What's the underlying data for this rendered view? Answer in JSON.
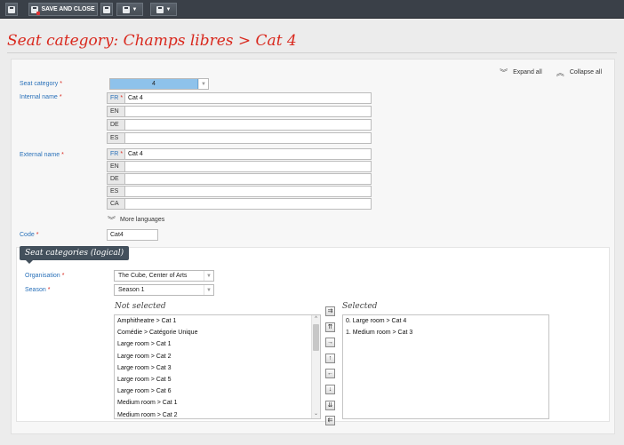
{
  "toolbar": {
    "save_and_close_label": "SAVE AND CLOSE"
  },
  "page": {
    "title": "Seat category: Champs libres > Cat 4"
  },
  "links": {
    "expand_all": "Expand all",
    "collapse_all": "Collapse all"
  },
  "form": {
    "seat_category": {
      "label": "Seat category",
      "value": "4"
    },
    "internal_name": {
      "label": "Internal name",
      "rows": [
        {
          "code": "FR",
          "value": "Cat 4"
        },
        {
          "code": "EN",
          "value": ""
        },
        {
          "code": "DE",
          "value": ""
        },
        {
          "code": "ES",
          "value": ""
        }
      ]
    },
    "external_name": {
      "label": "External name",
      "rows": [
        {
          "code": "FR",
          "value": "Cat 4"
        },
        {
          "code": "EN",
          "value": ""
        },
        {
          "code": "DE",
          "value": ""
        },
        {
          "code": "ES",
          "value": ""
        },
        {
          "code": "CA",
          "value": ""
        }
      ]
    },
    "more_languages": "More languages",
    "code": {
      "label": "Code",
      "value": "Cat4"
    },
    "required_marker": "*"
  },
  "logical": {
    "section_title": "Seat categories (logical)",
    "organisation": {
      "label": "Organisation",
      "value": "The Cube, Center of Arts"
    },
    "season": {
      "label": "Season",
      "value": "Season 1"
    },
    "not_selected_caption": "Not selected",
    "selected_caption": "Selected",
    "not_selected": [
      "Amphitheatre > Cat 1",
      "Comédie > Catégorie Unique",
      "Large room > Cat 1",
      "Large room > Cat 2",
      "Large room > Cat 3",
      "Large room > Cat 5",
      "Large room > Cat 6",
      "Medium room > Cat 1",
      "Medium room > Cat 2"
    ],
    "selected": [
      "0. Large room > Cat 4",
      "1. Medium room > Cat 3"
    ]
  },
  "glyphs": {
    "caret_down": "▼",
    "double_down": "≚",
    "scroll_up": "^",
    "scroll_down": "⌄"
  }
}
